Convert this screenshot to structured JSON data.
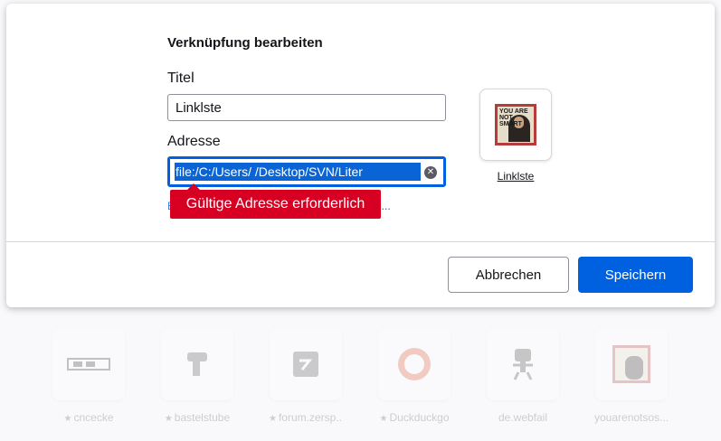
{
  "dialog": {
    "title": "Verknüpfung bearbeiten",
    "title_label": "Titel",
    "title_value": "Linklste",
    "address_label": "Adresse",
    "address_value": "file:/C:/Users/      /Desktop/SVN/Liter",
    "error_message": "Gültige Adresse erforderlich",
    "hint_start": "E",
    "hint_end": "n...",
    "preview_label": "Linklste",
    "preview_thumb_text": "YOU ARE NOT SMART",
    "cancel_label": "Abbrechen",
    "save_label": "Speichern"
  },
  "top_sites": [
    {
      "label": "cncecke",
      "icon": "cnc-logo"
    },
    {
      "label": "bastelstube",
      "icon": "drill-icon"
    },
    {
      "label": "forum.zersp...",
      "icon": "forum-logo"
    },
    {
      "label": "Duckduckgo",
      "icon": "duckduckgo-logo"
    },
    {
      "label": "de.webfail",
      "icon": "webfail-logo"
    },
    {
      "label": "youarenotsos...",
      "icon": "youarenotsosmart-logo"
    }
  ],
  "colors": {
    "accent": "#0061e0",
    "error": "#d70022",
    "selection": "#0a64d6"
  }
}
